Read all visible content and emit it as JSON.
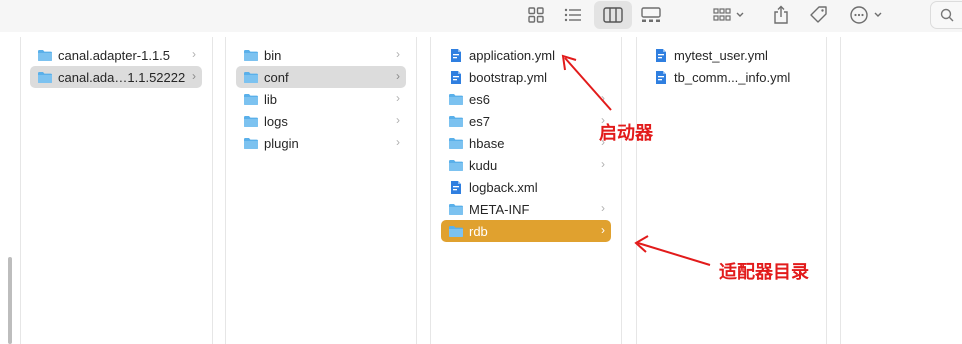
{
  "toolbar": {
    "icons": [
      "icon-view-icon",
      "list-view-icon",
      "column-view-icon",
      "gallery-view-icon",
      "group-icon",
      "share-icon",
      "tag-icon",
      "more-icon",
      "search-icon"
    ],
    "active_view": "column"
  },
  "columns": [
    {
      "items": [
        {
          "label": "canal.adapter-1.1.5",
          "type": "folder",
          "chevron": "›",
          "selected": false
        },
        {
          "label": "canal.ada…1.1.52222",
          "type": "folder",
          "chevron": "›",
          "selected": "gray"
        }
      ]
    },
    {
      "items": [
        {
          "label": "bin",
          "type": "folder",
          "chevron": "›",
          "selected": false
        },
        {
          "label": "conf",
          "type": "folder",
          "chevron": "›",
          "selected": "gray"
        },
        {
          "label": "lib",
          "type": "folder",
          "chevron": "›",
          "selected": false
        },
        {
          "label": "logs",
          "type": "folder",
          "chevron": "›",
          "selected": false
        },
        {
          "label": "plugin",
          "type": "folder",
          "chevron": "›",
          "selected": false
        }
      ]
    },
    {
      "items": [
        {
          "label": "application.yml",
          "type": "file",
          "chevron": "",
          "selected": false
        },
        {
          "label": "bootstrap.yml",
          "type": "file",
          "chevron": "",
          "selected": false
        },
        {
          "label": "es6",
          "type": "folder",
          "chevron": "›",
          "selected": false
        },
        {
          "label": "es7",
          "type": "folder",
          "chevron": "›",
          "selected": false
        },
        {
          "label": "hbase",
          "type": "folder",
          "chevron": "›",
          "selected": false
        },
        {
          "label": "kudu",
          "type": "folder",
          "chevron": "›",
          "selected": false
        },
        {
          "label": "logback.xml",
          "type": "file",
          "chevron": "",
          "selected": false
        },
        {
          "label": "META-INF",
          "type": "folder",
          "chevron": "›",
          "selected": false
        },
        {
          "label": "rdb",
          "type": "folder",
          "chevron": "›",
          "selected": "orange"
        }
      ]
    },
    {
      "items": [
        {
          "label": "mytest_user.yml",
          "type": "file",
          "chevron": "",
          "selected": false
        },
        {
          "label": "tb_comm..._info.yml",
          "type": "file",
          "chevron": "",
          "selected": false
        }
      ]
    }
  ],
  "annotations": {
    "launcher_label": "启动器",
    "adapter_dir_label": "适配器目录"
  },
  "colors": {
    "accent_selection": "#e0a12f",
    "gray_selection": "#dcdcdc",
    "folder_blue": "#5ab0ea",
    "annotation_red": "#e21b1b"
  }
}
